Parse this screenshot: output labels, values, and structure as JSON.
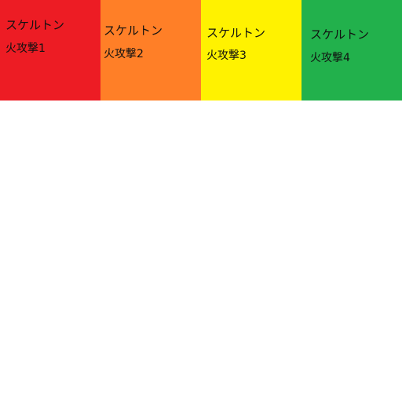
{
  "cards": [
    {
      "name": "スケルトン",
      "attack": "火攻撃1",
      "color": "#ED1C24"
    },
    {
      "name": "スケルトン",
      "attack": "火攻撃2",
      "color": "#FF7F27"
    },
    {
      "name": "スケルトン",
      "attack": "火攻撃3",
      "color": "#FFF200"
    },
    {
      "name": "スケルトン",
      "attack": "火攻撃4",
      "color": "#22B14C"
    }
  ]
}
